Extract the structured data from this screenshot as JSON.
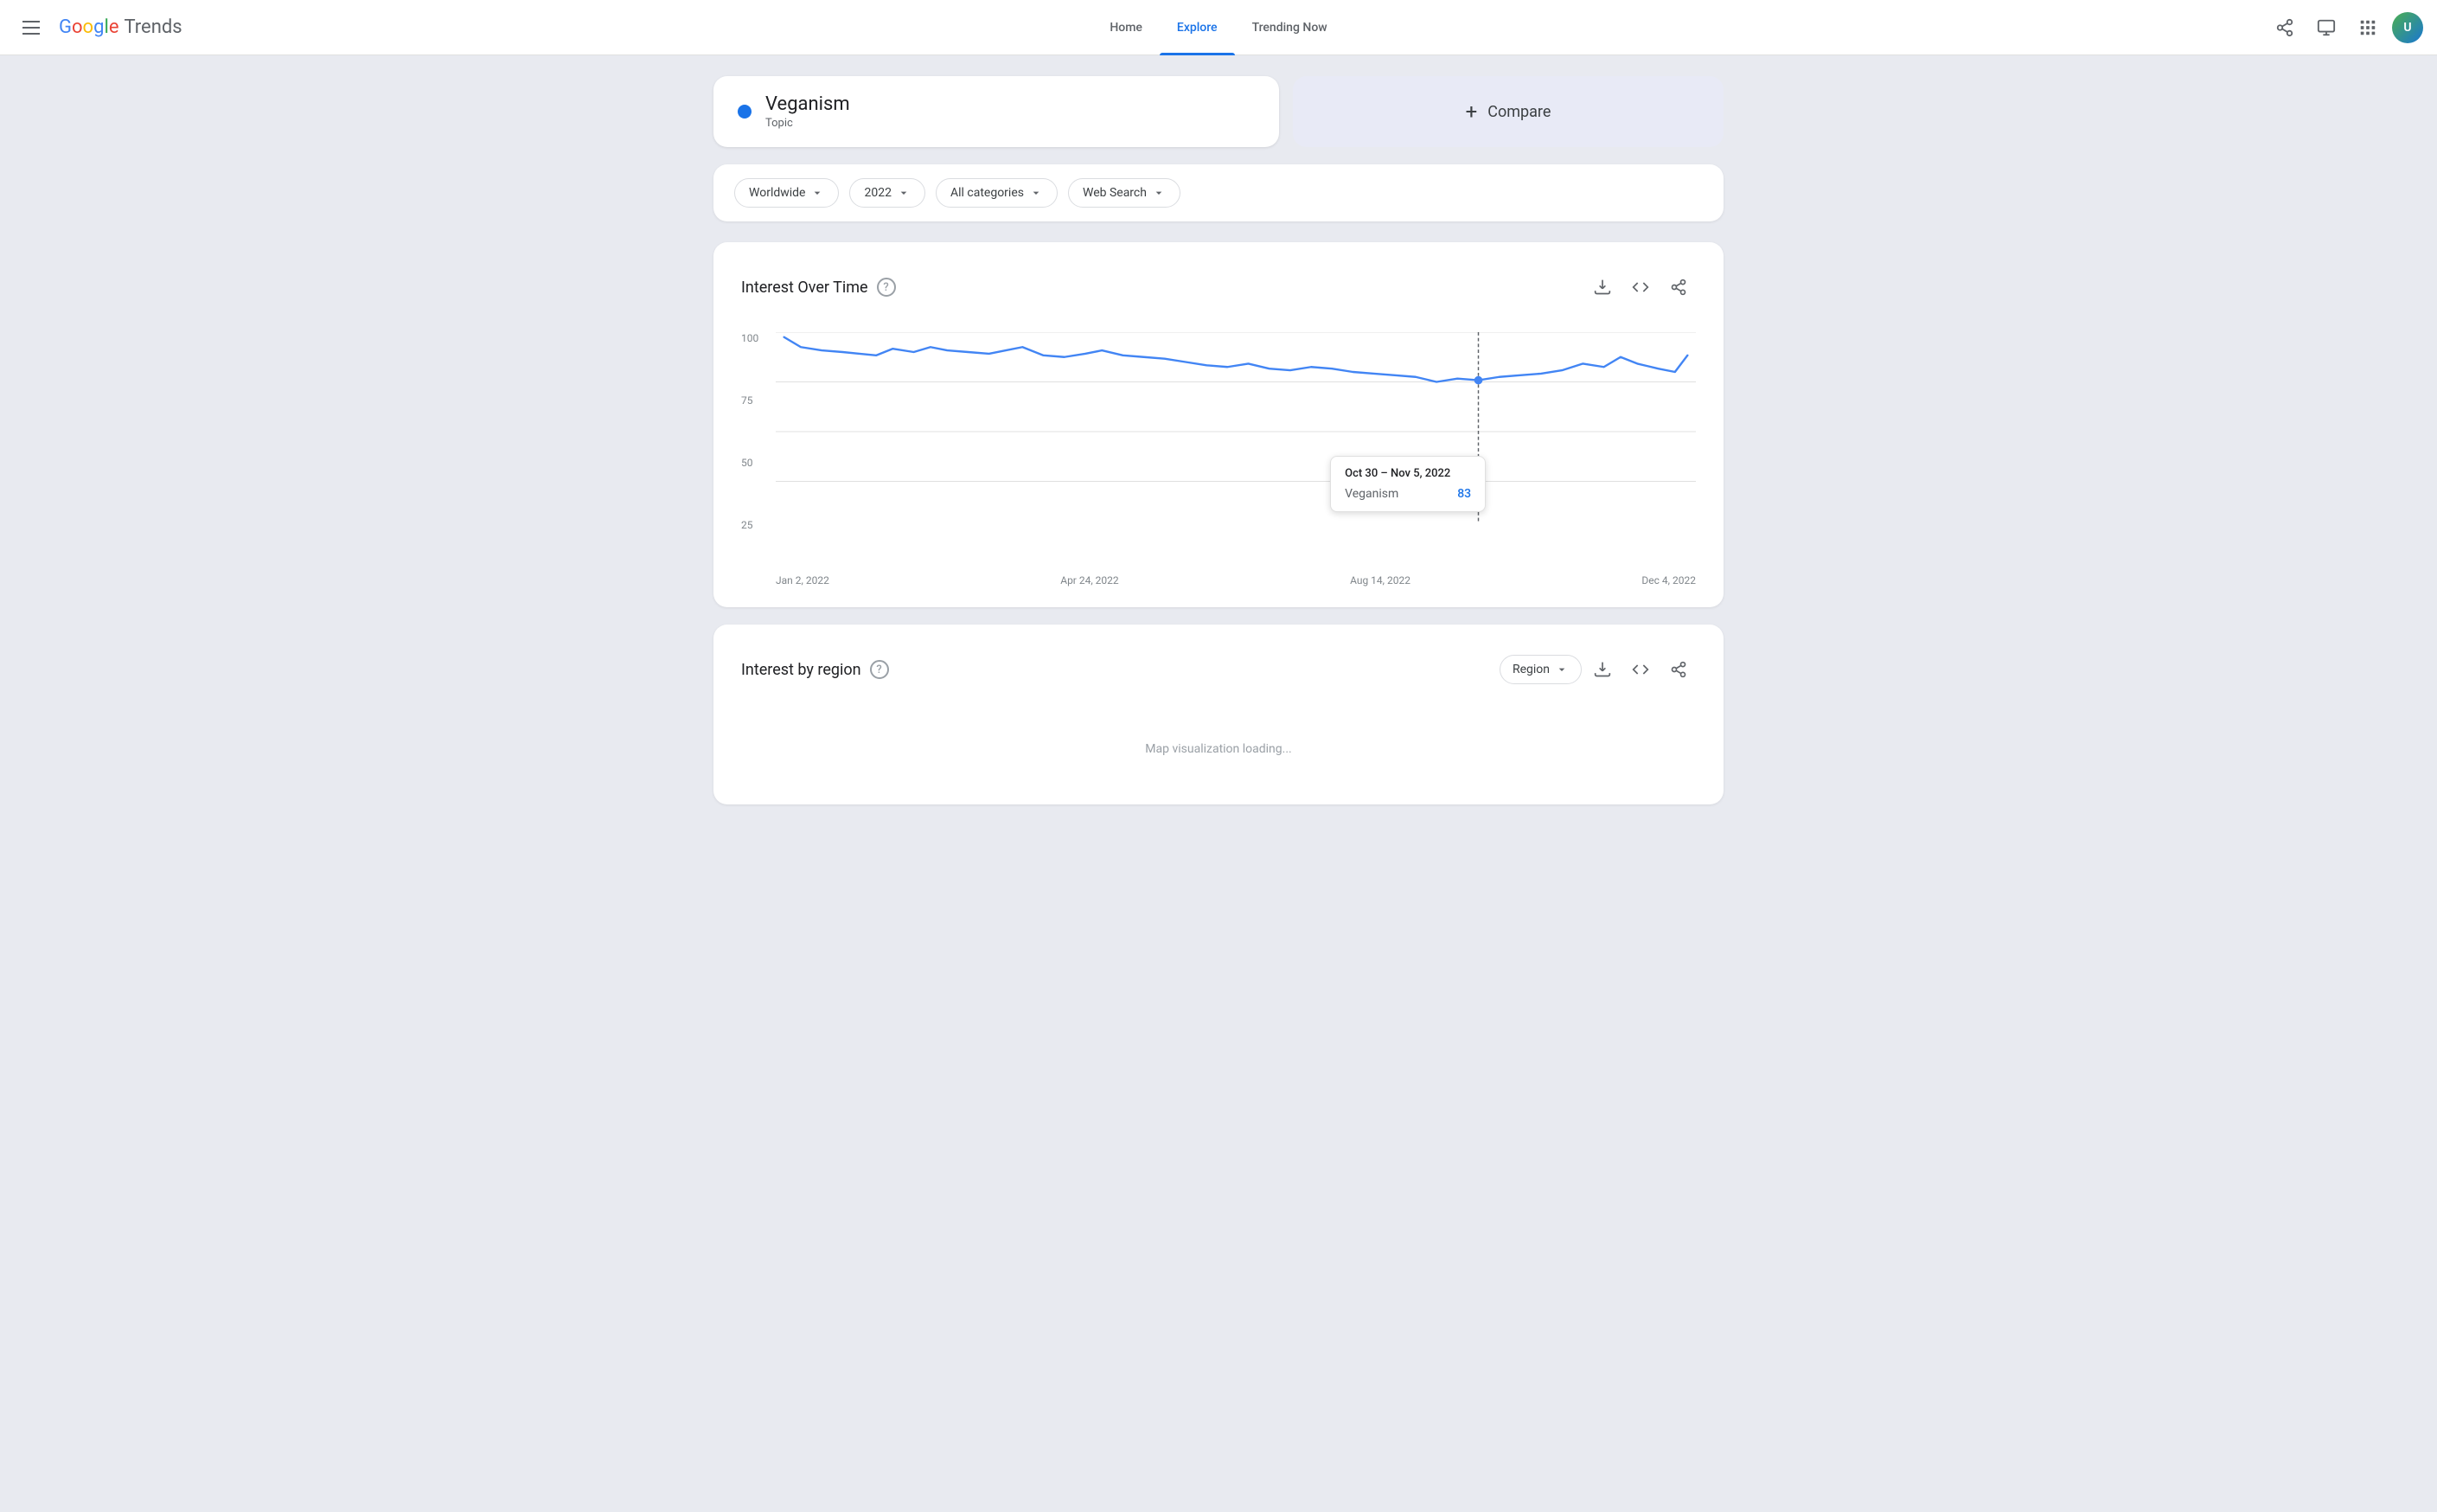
{
  "app": {
    "title": "Google Trends"
  },
  "nav": {
    "home_label": "Home",
    "explore_label": "Explore",
    "trending_label": "Trending Now",
    "active": "explore"
  },
  "search": {
    "term": "Veganism",
    "type": "Topic",
    "compare_label": "Compare",
    "dot_color": "#1a73e8"
  },
  "filters": {
    "location": "Worldwide",
    "year": "2022",
    "category": "All categories",
    "search_type": "Web Search"
  },
  "interest_over_time": {
    "title": "Interest Over Time",
    "y_labels": [
      "100",
      "75",
      "50",
      "25"
    ],
    "x_labels": [
      "Jan 2, 2022",
      "Apr 24, 2022",
      "Aug 14, 2022",
      "Dec 4, 2022"
    ],
    "tooltip": {
      "date": "Oct 30 – Nov 5, 2022",
      "term": "Veganism",
      "value": "83"
    }
  },
  "interest_by_region": {
    "title": "Interest by region",
    "region_label": "Region"
  },
  "icons": {
    "download": "⬇",
    "code": "<>",
    "share": "share",
    "help": "?",
    "hamburger": "menu",
    "apps": "apps"
  }
}
